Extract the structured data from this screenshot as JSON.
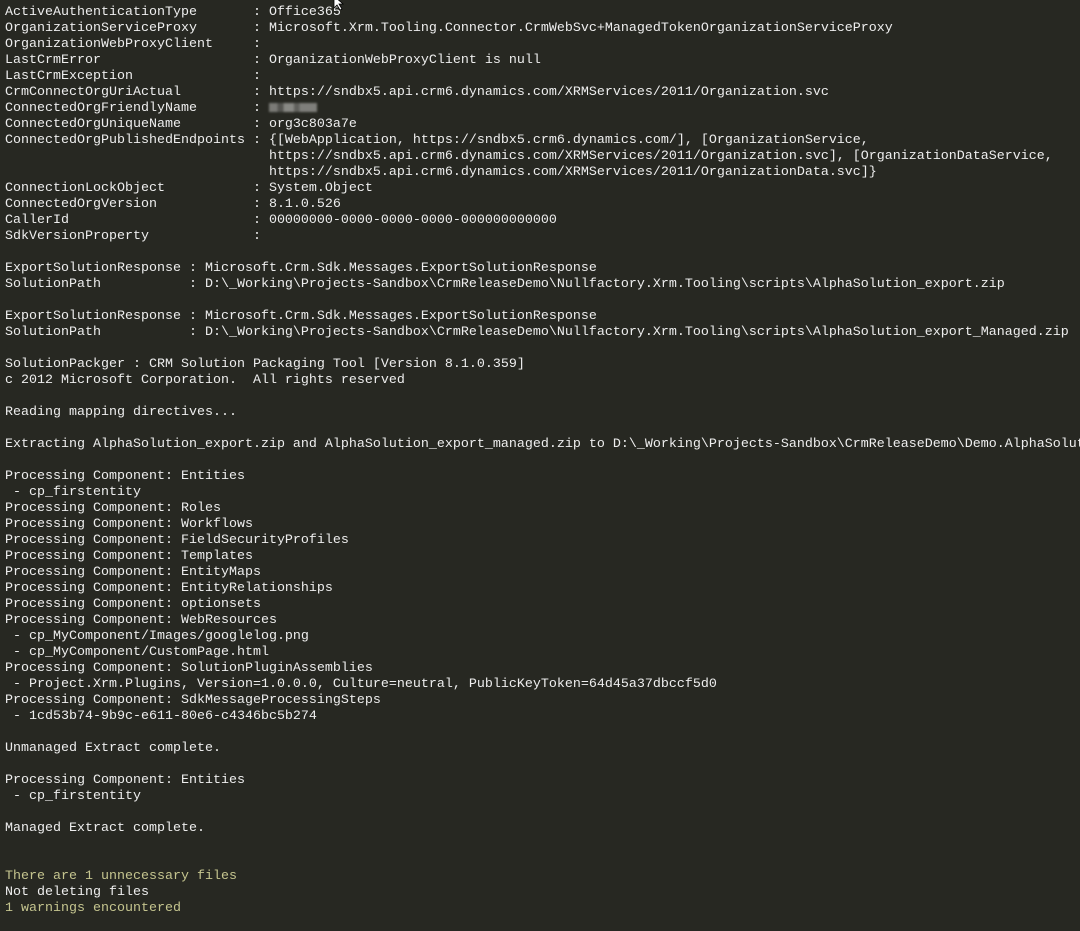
{
  "colors": {
    "background": "#272822",
    "text": "#eeeeee",
    "warning": "#c5c58f"
  },
  "console": {
    "lines": [
      {
        "text": "ActiveAuthenticationType       : Office365"
      },
      {
        "text": "OrganizationServiceProxy       : Microsoft.Xrm.Tooling.Connector.CrmWebSvc+ManagedTokenOrganizationServiceProxy"
      },
      {
        "text": "OrganizationWebProxyClient     :"
      },
      {
        "text": "LastCrmError                   : OrganizationWebProxyClient is null"
      },
      {
        "text": "LastCrmException               :"
      },
      {
        "text": "CrmConnectOrgUriActual         : https://sndbx5.api.crm6.dynamics.com/XRMServices/2011/Organization.svc"
      },
      {
        "text": "ConnectedOrgFriendlyName       : ",
        "redacted": true
      },
      {
        "text": "ConnectedOrgUniqueName         : org3c803a7e"
      },
      {
        "text": "ConnectedOrgPublishedEndpoints : {[WebApplication, https://sndbx5.crm6.dynamics.com/], [OrganizationService,"
      },
      {
        "text": "                                 https://sndbx5.api.crm6.dynamics.com/XRMServices/2011/Organization.svc], [OrganizationDataService,"
      },
      {
        "text": "                                 https://sndbx5.api.crm6.dynamics.com/XRMServices/2011/OrganizationData.svc]}"
      },
      {
        "text": "ConnectionLockObject           : System.Object"
      },
      {
        "text": "ConnectedOrgVersion            : 8.1.0.526"
      },
      {
        "text": "CallerId                       : 00000000-0000-0000-0000-000000000000"
      },
      {
        "text": "SdkVersionProperty             :"
      },
      {
        "text": ""
      },
      {
        "text": "ExportSolutionResponse : Microsoft.Crm.Sdk.Messages.ExportSolutionResponse"
      },
      {
        "text": "SolutionPath           : D:\\_Working\\Projects-Sandbox\\CrmReleaseDemo\\Nullfactory.Xrm.Tooling\\scripts\\AlphaSolution_export.zip"
      },
      {
        "text": ""
      },
      {
        "text": "ExportSolutionResponse : Microsoft.Crm.Sdk.Messages.ExportSolutionResponse"
      },
      {
        "text": "SolutionPath           : D:\\_Working\\Projects-Sandbox\\CrmReleaseDemo\\Nullfactory.Xrm.Tooling\\scripts\\AlphaSolution_export_Managed.zip"
      },
      {
        "text": ""
      },
      {
        "text": "SolutionPackger : CRM Solution Packaging Tool [Version 8.1.0.359]"
      },
      {
        "text": "c 2012 Microsoft Corporation.  All rights reserved"
      },
      {
        "text": ""
      },
      {
        "text": "Reading mapping directives..."
      },
      {
        "text": ""
      },
      {
        "text": "Extracting AlphaSolution_export.zip and AlphaSolution_export_managed.zip to D:\\_Working\\Projects-Sandbox\\CrmReleaseDemo\\Demo.AlphaSolut"
      },
      {
        "text": ""
      },
      {
        "text": "Processing Component: Entities"
      },
      {
        "text": " - cp_firstentity"
      },
      {
        "text": "Processing Component: Roles"
      },
      {
        "text": "Processing Component: Workflows"
      },
      {
        "text": "Processing Component: FieldSecurityProfiles"
      },
      {
        "text": "Processing Component: Templates"
      },
      {
        "text": "Processing Component: EntityMaps"
      },
      {
        "text": "Processing Component: EntityRelationships"
      },
      {
        "text": "Processing Component: optionsets"
      },
      {
        "text": "Processing Component: WebResources"
      },
      {
        "text": " - cp_MyComponent/Images/googlelog.png"
      },
      {
        "text": " - cp_MyComponent/CustomPage.html"
      },
      {
        "text": "Processing Component: SolutionPluginAssemblies"
      },
      {
        "text": " - Project.Xrm.Plugins, Version=1.0.0.0, Culture=neutral, PublicKeyToken=64d45a37dbccf5d0"
      },
      {
        "text": "Processing Component: SdkMessageProcessingSteps"
      },
      {
        "text": " - 1cd53b74-9b9c-e611-80e6-c4346bc5b274"
      },
      {
        "text": ""
      },
      {
        "text": "Unmanaged Extract complete."
      },
      {
        "text": ""
      },
      {
        "text": "Processing Component: Entities"
      },
      {
        "text": " - cp_firstentity"
      },
      {
        "text": ""
      },
      {
        "text": "Managed Extract complete."
      },
      {
        "text": ""
      },
      {
        "text": ""
      },
      {
        "text": "There are 1 unnecessary files",
        "level": "warning"
      },
      {
        "text": "Not deleting files"
      },
      {
        "text": "1 warnings encountered",
        "level": "warning"
      }
    ]
  },
  "icons": {
    "cursor": "mouse-pointer-icon"
  }
}
